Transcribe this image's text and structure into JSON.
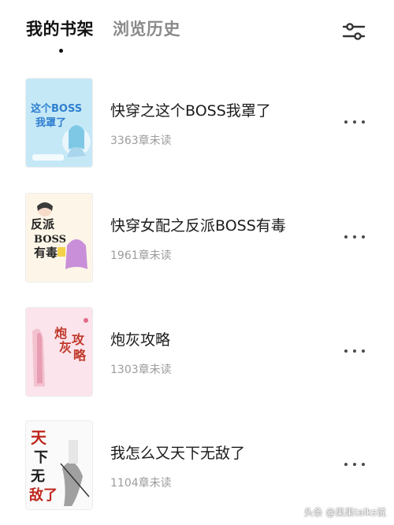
{
  "tabs": {
    "bookshelf": "我的书架",
    "history": "浏览历史"
  },
  "toolbar": {
    "filter_icon": "sliders-icon"
  },
  "books": [
    {
      "title": "快穿之这个BOSS我罩了",
      "progress": "3363章未读",
      "cover_text": "这个BOSS我罩了",
      "cover_color": "#bfe4f5"
    },
    {
      "title": "快穿女配之反派BOSS有毒",
      "progress": "1961章未读",
      "cover_text": "反派BOSS有毒",
      "cover_color": "#fdf6e8"
    },
    {
      "title": "炮灰攻略",
      "progress": "1303章未读",
      "cover_text": "炮灰攻略",
      "cover_color": "#fbe3ea"
    },
    {
      "title": "我怎么又天下无敌了",
      "progress": "1104章未读",
      "cover_text": "天下无敌了",
      "cover_color": "#fafafa"
    }
  ],
  "more_icon": "more-horizontal-icon",
  "watermark": "头条 @果果talks说"
}
